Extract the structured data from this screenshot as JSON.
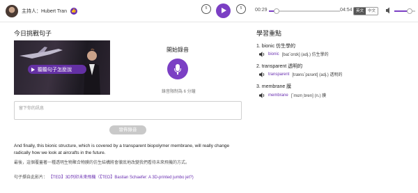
{
  "player": {
    "host_label": "主持人：Hubert Tran",
    "rewind_label": "5",
    "forward_label": "5",
    "current_time": "00:29",
    "total_time": "04:54",
    "progress": 0.11,
    "speed_on": "英文",
    "speed_off": "中文",
    "volume": 0.67
  },
  "lesson": {
    "title": "今日挑戰句子",
    "video_button": "聽聽句子怎麼說",
    "record_title": "開始錄音",
    "record_hint": "錄音限制為 6 分鐘",
    "message_placeholder": "留下你的訊息",
    "submit_label": "發佈錄音",
    "sentence_en": "And finally, this bionic structure, which is covered by a transparent biopolymer membrane, will really change radically how we look at aircrafts in the future.",
    "sentence_zh": "最後，這個覆蓋著一種透明生物聚合物膜的仿生結構將會徹底地改變我們看待未來飛機的方式。",
    "source_prefix": "句子擷自此影片：",
    "source_link": "【TED】3D列印未來飛機（【TED】Bastian Schaefer: A 3D-printed jumbo jet?)"
  },
  "key_points": {
    "title": "學習重點",
    "items": [
      {
        "heading": "1. bionic 仿生學的",
        "word": "bionic",
        "definition": "[baɪˋɑnɪk] (adj.) 仿生學的"
      },
      {
        "heading": "2. transparent 透明的",
        "word": "transparent",
        "definition": "[trænsˋpɛrənt] (adj.) 透明的"
      },
      {
        "heading": "3. membrane 膜",
        "word": "membrane",
        "definition": "[ˋmɛm͵bren] (n.) 膜"
      }
    ]
  },
  "colors": {
    "accent": "#7b3fc4",
    "link": "#6a2fb1",
    "disabled": "#c9c9c9"
  }
}
